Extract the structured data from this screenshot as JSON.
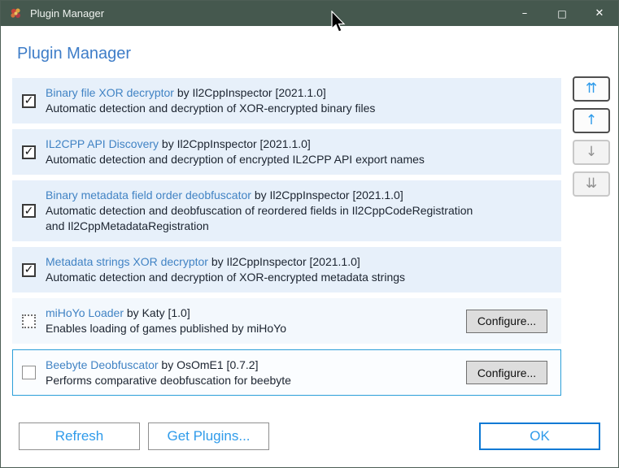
{
  "window": {
    "title": "Plugin Manager",
    "controls": {
      "minimize": "–",
      "maximize": "□",
      "close": "✕"
    }
  },
  "heading": "Plugin Manager",
  "check_glyph": "✓",
  "plugins": [
    {
      "name": "Binary file XOR decryptor",
      "byline": "by Il2CppInspector [2021.1.0]",
      "description": "Automatic detection and decryption of XOR-encrypted binary files",
      "state": "checked",
      "has_configure": false,
      "selected": false
    },
    {
      "name": "IL2CPP API Discovery",
      "byline": "by Il2CppInspector [2021.1.0]",
      "description": "Automatic detection and decryption of encrypted IL2CPP API export names",
      "state": "checked",
      "has_configure": false,
      "selected": false
    },
    {
      "name": "Binary metadata field order deobfuscator",
      "byline": "by Il2CppInspector [2021.1.0]",
      "description": "Automatic detection and deobfuscation of reordered fields in Il2CppCodeRegistration and Il2CppMetadataRegistration",
      "state": "checked",
      "has_configure": false,
      "selected": false
    },
    {
      "name": "Metadata strings XOR decryptor",
      "byline": "by Il2CppInspector [2021.1.0]",
      "description": "Automatic detection and decryption of XOR-encrypted metadata strings",
      "state": "checked",
      "has_configure": false,
      "selected": false
    },
    {
      "name": "miHoYo Loader",
      "byline": "by Katy [1.0]",
      "description": "Enables loading of games published by miHoYo",
      "state": "indeterminate",
      "has_configure": true,
      "row_tint": "alt",
      "selected": false
    },
    {
      "name": "Beebyte Deobfuscator",
      "byline": "by OsOmE1 [0.7.2]",
      "description": "Performs comparative deobfuscation for beebyte",
      "state": "unchecked",
      "has_configure": true,
      "selected": true
    }
  ],
  "buttons": {
    "configure": "Configure...",
    "refresh": "Refresh",
    "get_plugins": "Get Plugins...",
    "ok": "OK"
  },
  "order_buttons": [
    {
      "name": "move-to-top",
      "glyph": "⇈",
      "enabled": true
    },
    {
      "name": "move-up",
      "glyph": "↑",
      "enabled": true
    },
    {
      "name": "move-down",
      "glyph": "↓",
      "enabled": false
    },
    {
      "name": "move-to-bottom",
      "glyph": "⇊",
      "enabled": false
    }
  ],
  "colors": {
    "titlebar": "#45584e",
    "heading_blue": "#3e7dc8",
    "link_blue": "#4183c4",
    "row_background": "#e7f0fa",
    "selected_border": "#2b9fd9",
    "accent_blue": "#2f9bea",
    "ok_border": "#0c79d4"
  }
}
